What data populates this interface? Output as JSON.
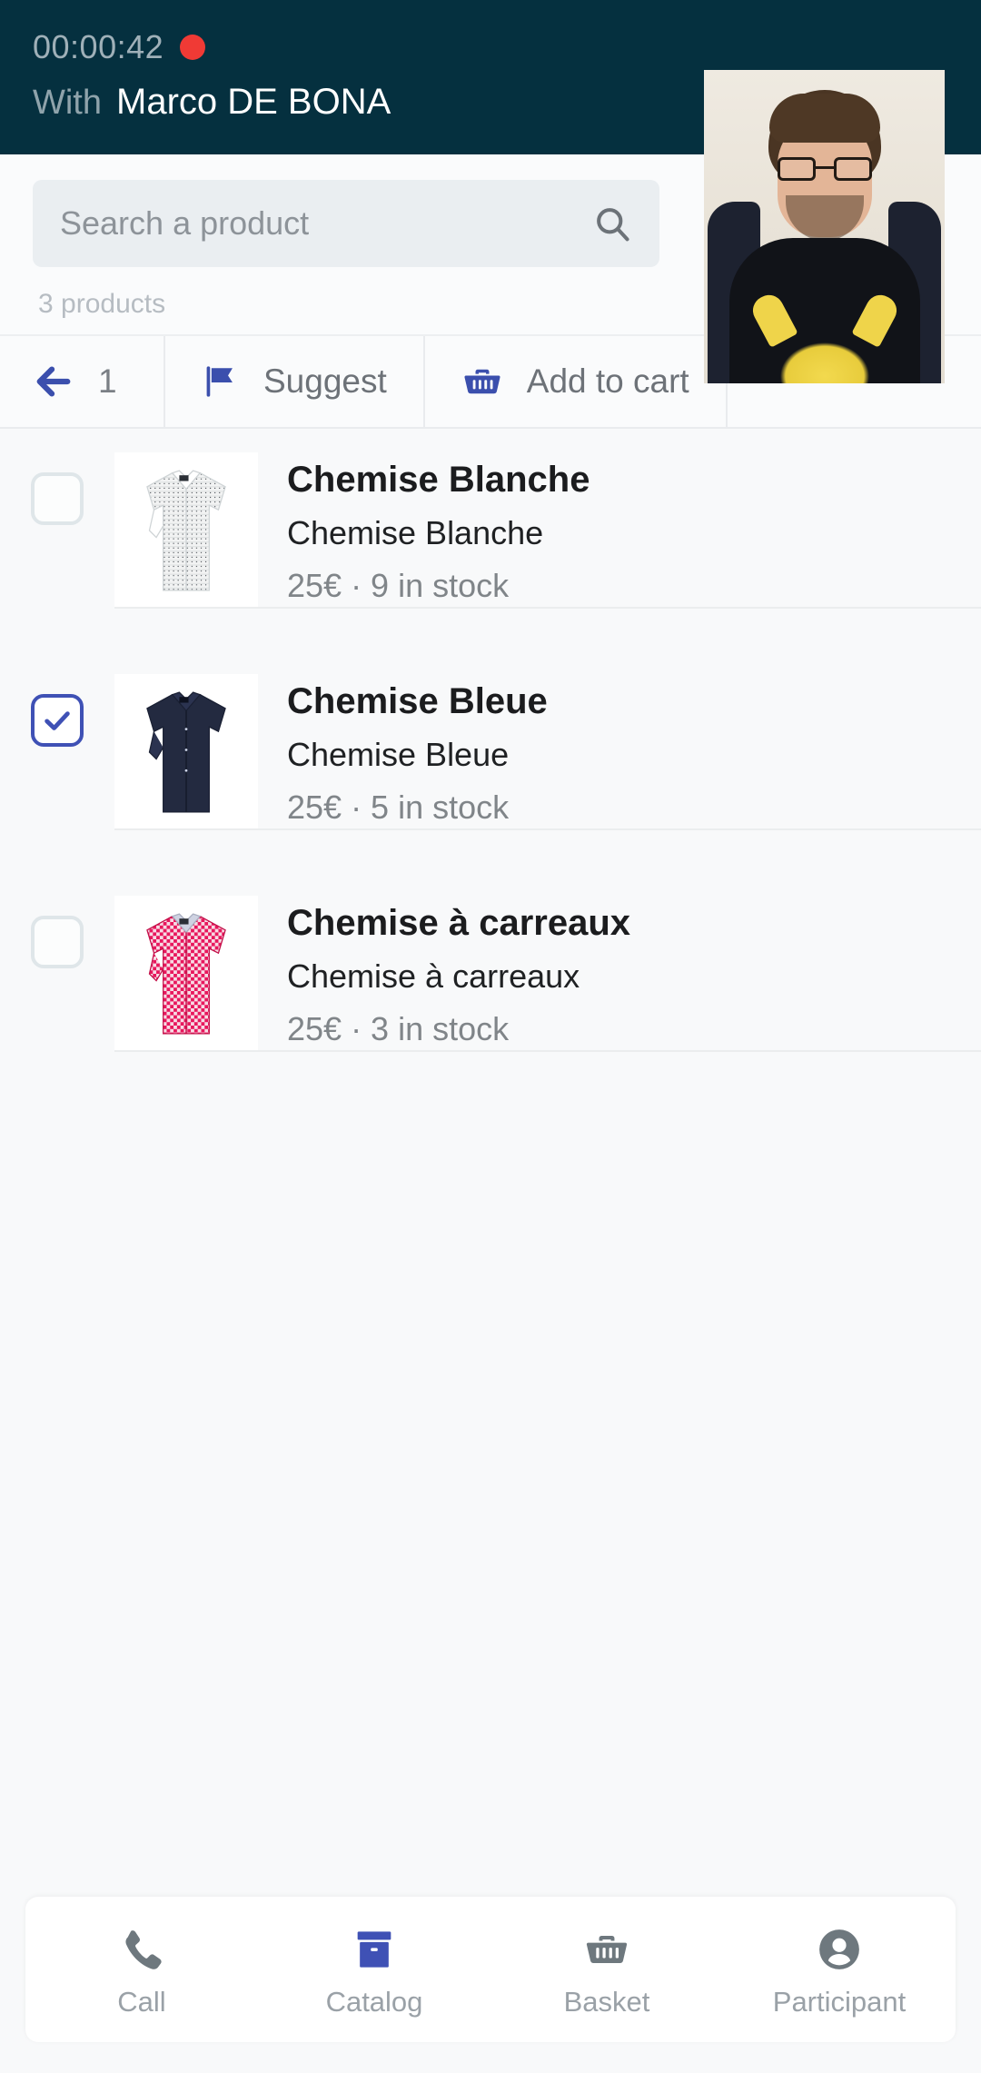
{
  "header": {
    "timer": "00:00:42",
    "rec_indicator": "recording-dot",
    "with_label": "With",
    "participant_name": "Marco DE BONA"
  },
  "search": {
    "placeholder": "Search a product",
    "value": "",
    "icon": "search-icon",
    "result_count": "3 products"
  },
  "action_bar": {
    "back_icon": "arrow-left-icon",
    "page_number": "1",
    "suggest": {
      "icon": "flag-icon",
      "label": "Suggest"
    },
    "add_to_cart": {
      "icon": "basket-icon",
      "label": "Add to cart"
    }
  },
  "products": [
    {
      "checked": false,
      "title": "Chemise Blanche",
      "subtitle": "Chemise Blanche",
      "meta": "25€ · 9 in stock",
      "price": "25€",
      "stock": "9 in stock",
      "thumb": "white-shirt"
    },
    {
      "checked": true,
      "title": "Chemise Bleue",
      "subtitle": "Chemise Bleue",
      "meta": "25€ · 5 in stock",
      "price": "25€",
      "stock": "5 in stock",
      "thumb": "blue-shirt"
    },
    {
      "checked": false,
      "title": "Chemise à carreaux",
      "subtitle": "Chemise à carreaux",
      "meta": "25€ · 3 in stock",
      "price": "25€",
      "stock": "3 in stock",
      "thumb": "checkered-shirt"
    }
  ],
  "bottom_nav": [
    {
      "icon": "phone-icon",
      "label": "Call",
      "active": false
    },
    {
      "icon": "catalog-box-icon",
      "label": "Catalog",
      "active": true
    },
    {
      "icon": "basket-icon",
      "label": "Basket",
      "active": false
    },
    {
      "icon": "person-icon",
      "label": "Participant",
      "active": false
    }
  ],
  "colors": {
    "header_bg": "#05303f",
    "accent": "#3f51b5",
    "rec_red": "#f03a35",
    "page_bg": "#f8f9fa",
    "muted_text": "#8d9399"
  }
}
